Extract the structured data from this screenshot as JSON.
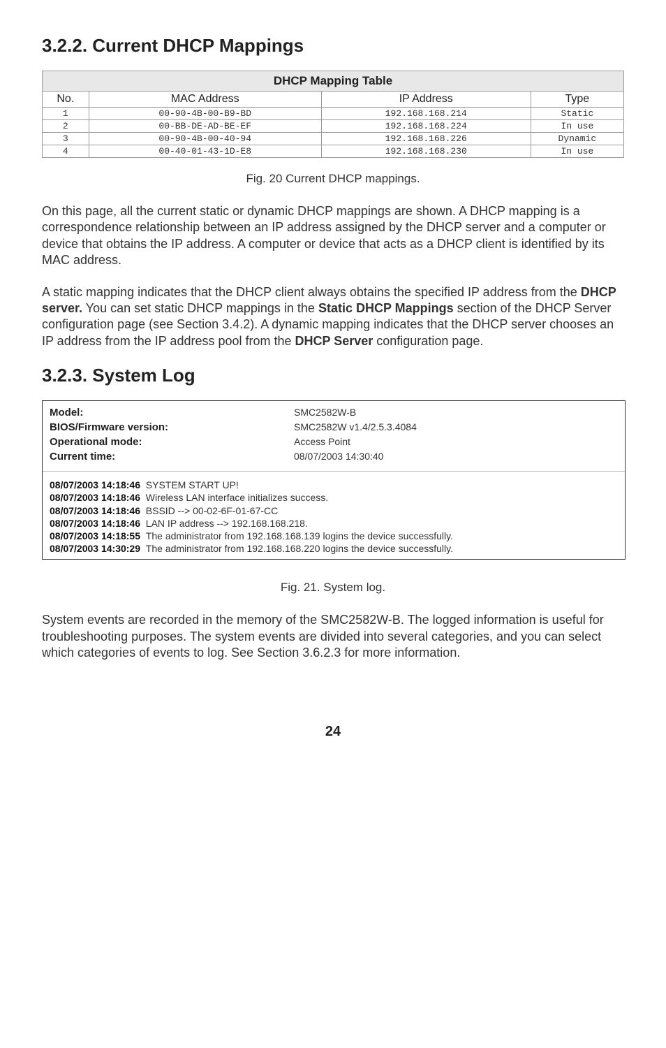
{
  "headings": {
    "h1": "3.2.2. Current DHCP Mappings",
    "h2": "3.2.3. System Log"
  },
  "dhcp_table": {
    "title": "DHCP Mapping Table",
    "headers": [
      "No.",
      "MAC Address",
      "IP Address",
      "Type"
    ],
    "rows": [
      [
        "1",
        "00-90-4B-00-B9-BD",
        "192.168.168.214",
        "Static"
      ],
      [
        "2",
        "00-BB-DE-AD-BE-EF",
        "192.168.168.224",
        "In use"
      ],
      [
        "3",
        "00-90-4B-00-40-94",
        "192.168.168.226",
        "Dynamic"
      ],
      [
        "4",
        "00-40-01-43-1D-E8",
        "192.168.168.230",
        "In use"
      ]
    ]
  },
  "captions": {
    "fig20": "Fig. 20  Current DHCP mappings.",
    "fig21": "Fig. 21. System log."
  },
  "paragraphs": {
    "p1": "On this page, all the current static or dynamic DHCP mappings are shown. A DHCP mapping is a correspondence relationship between an IP address assigned by the DHCP server and a computer or device that obtains the IP address. A computer or device that acts as a DHCP client is identified by its MAC address.",
    "p2a": "A static mapping indicates that the DHCP client always obtains the specified IP address from the ",
    "p2b": "DHCP server.",
    "p2c": " You can set static DHCP mappings in the ",
    "p2d": "Static DHCP Mappings",
    "p2e": " section of the DHCP Server configuration page (see Section 3.4.2). A dynamic mapping indicates that the DHCP server chooses an IP address from the IP address pool from the ",
    "p2f": "DHCP Server",
    "p2g": " configuration page.",
    "p3": "System events are recorded in the memory of the SMC2582W-B. The logged information is useful for troubleshooting purposes. The system events are divided into several categories, and you can select which categories of events to log. See Section 3.6.2.3 for more information."
  },
  "syslog": {
    "info": [
      {
        "label": "Model:",
        "value": "SMC2582W-B"
      },
      {
        "label": "BIOS/Firmware version:",
        "value": "SMC2582W v1.4/2.5.3.4084"
      },
      {
        "label": "Operational mode:",
        "value": "Access Point"
      },
      {
        "label": "Current time:",
        "value": "08/07/2003 14:30:40"
      }
    ],
    "entries": [
      {
        "ts": "08/07/2003 14:18:46",
        "msg": "SYSTEM START UP!"
      },
      {
        "ts": "08/07/2003 14:18:46",
        "msg": "Wireless LAN interface initializes success."
      },
      {
        "ts": "08/07/2003 14:18:46",
        "msg": "BSSID --> 00-02-6F-01-67-CC"
      },
      {
        "ts": "08/07/2003 14:18:46",
        "msg": "LAN IP address --> 192.168.168.218."
      },
      {
        "ts": "08/07/2003 14:18:55",
        "msg": "The administrator from 192.168.168.139 logins the device successfully."
      },
      {
        "ts": "08/07/2003 14:30:29",
        "msg": "The administrator from 192.168.168.220 logins the device successfully."
      }
    ]
  },
  "page_number": "24"
}
